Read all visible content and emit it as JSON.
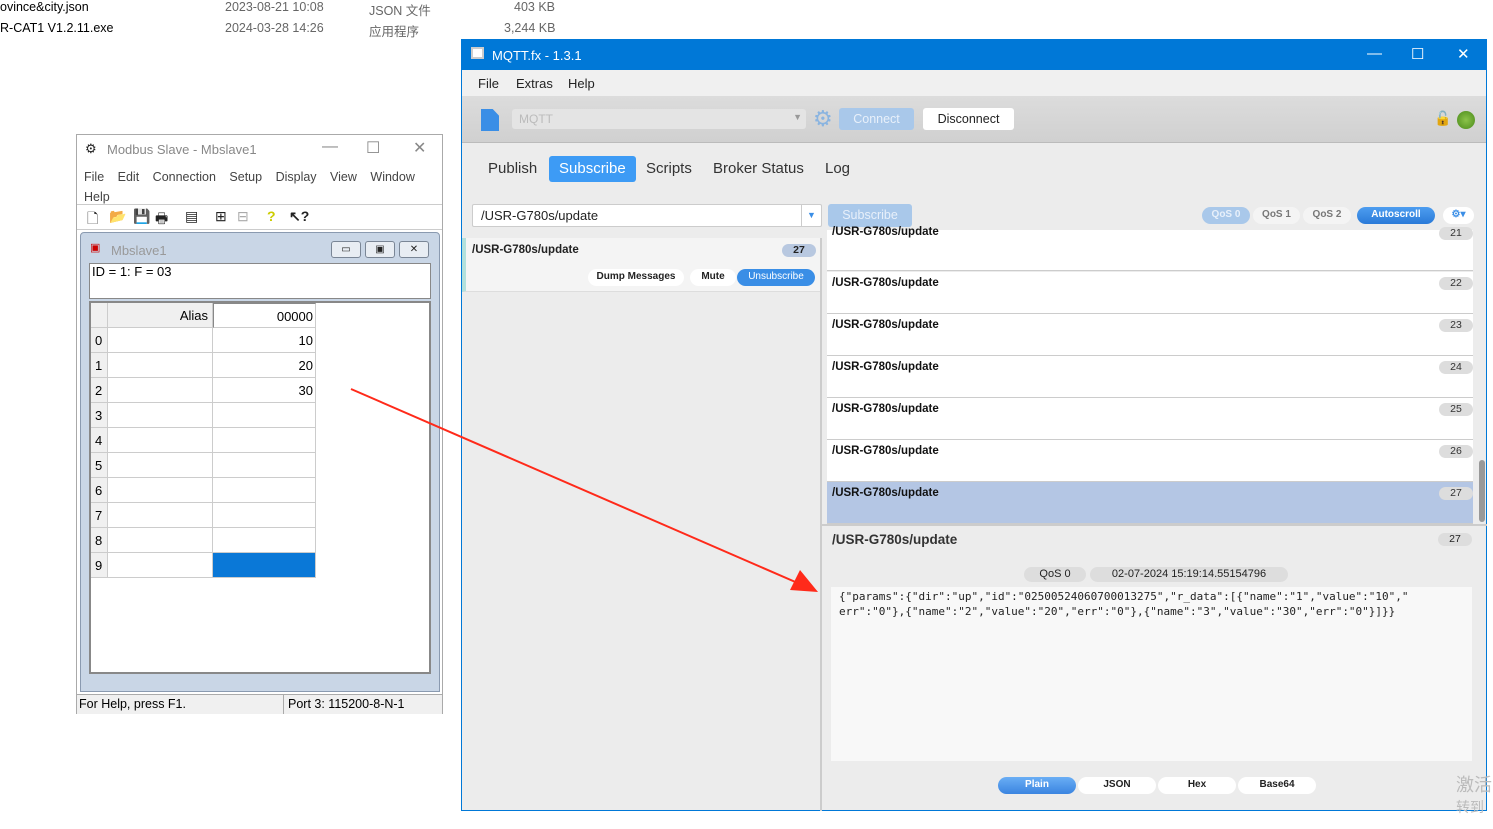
{
  "files": [
    {
      "name": "ovince&city.json",
      "date": "2023-08-21 10:08",
      "type": "JSON 文件",
      "size": "403 KB"
    },
    {
      "name": "R-CAT1 V1.2.11.exe",
      "date": "2024-03-28 14:26",
      "type": "应用程序",
      "size": "3,244 KB"
    }
  ],
  "modbus": {
    "title": "Modbus Slave - Mbslave1",
    "menu": [
      "File",
      "Edit",
      "Connection",
      "Setup",
      "Display",
      "View",
      "Window",
      "Help"
    ],
    "child_title": "Mbslave1",
    "id_line": "ID = 1: F = 03",
    "headers": {
      "alias": "Alias",
      "col": "00000"
    },
    "rows": [
      {
        "i": "0",
        "v": "10"
      },
      {
        "i": "1",
        "v": "20"
      },
      {
        "i": "2",
        "v": "30"
      },
      {
        "i": "3",
        "v": ""
      },
      {
        "i": "4",
        "v": ""
      },
      {
        "i": "5",
        "v": ""
      },
      {
        "i": "6",
        "v": ""
      },
      {
        "i": "7",
        "v": ""
      },
      {
        "i": "8",
        "v": ""
      },
      {
        "i": "9",
        "v": ""
      }
    ],
    "status_help": "For Help, press F1.",
    "status_port": "Port 3: 115200-8-N-1"
  },
  "mqtt": {
    "title": "MQTT.fx - 1.3.1",
    "menu": [
      "File",
      "Extras",
      "Help"
    ],
    "profile": "MQTT",
    "connect": "Connect",
    "disconnect": "Disconnect",
    "tabs": [
      "Publish",
      "Subscribe",
      "Scripts",
      "Broker Status",
      "Log"
    ],
    "active_tab": "Subscribe",
    "topic_input": "/USR-G780s/update",
    "subscribe_btn": "Subscribe",
    "qos": [
      "QoS 0",
      "QoS 1",
      "QoS 2"
    ],
    "autoscroll": "Autoscroll",
    "subscription": {
      "topic": "/USR-G780s/update",
      "count": "27",
      "dump": "Dump Messages",
      "mute": "Mute",
      "unsubscribe": "Unsubscribe"
    },
    "messages": [
      {
        "topic": "/USR-G780s/update",
        "n": "21"
      },
      {
        "topic": "/USR-G780s/update",
        "n": "22"
      },
      {
        "topic": "/USR-G780s/update",
        "n": "23"
      },
      {
        "topic": "/USR-G780s/update",
        "n": "24"
      },
      {
        "topic": "/USR-G780s/update",
        "n": "25"
      },
      {
        "topic": "/USR-G780s/update",
        "n": "26"
      },
      {
        "topic": "/USR-G780s/update",
        "n": "27"
      }
    ],
    "detail": {
      "topic": "/USR-G780s/update",
      "n": "27",
      "qos": "QoS 0",
      "time": "02-07-2024  15:19:14.55154796",
      "payload": "{\"params\":{\"dir\":\"up\",\"id\":\"02500524060700013275\",\"r_data\":[{\"name\":\"1\",\"value\":\"10\",\"\nerr\":\"0\"},{\"name\":\"2\",\"value\":\"20\",\"err\":\"0\"},{\"name\":\"3\",\"value\":\"30\",\"err\":\"0\"}]}}"
    },
    "formats": [
      "Plain",
      "JSON",
      "Hex",
      "Base64"
    ]
  },
  "watermark": [
    "激活",
    "转到"
  ],
  "colors": {
    "accent": "#0078d7",
    "tab_active": "#3d9bf5",
    "selected_row": "#b4c6e4",
    "arrow": "#ff2a1a"
  }
}
